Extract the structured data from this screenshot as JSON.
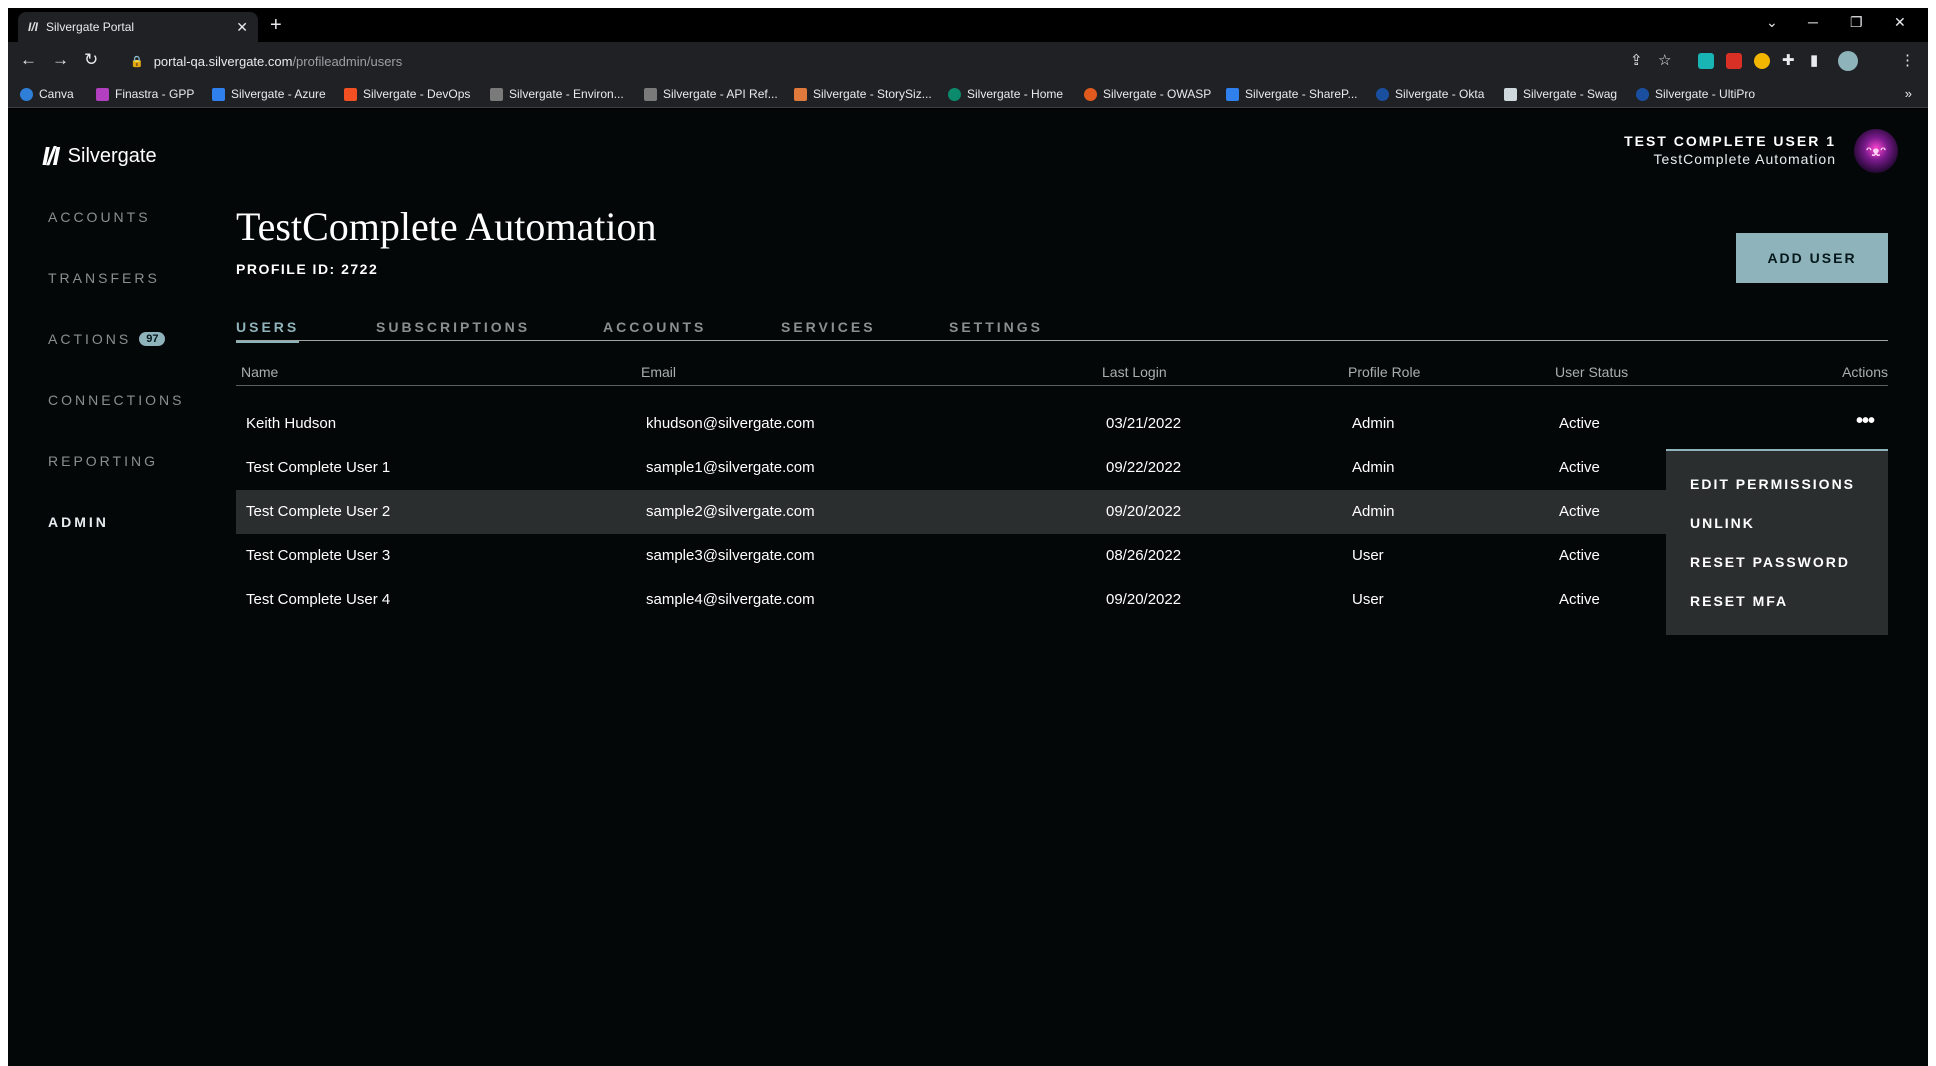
{
  "browser": {
    "tab_title": "Silvergate Portal",
    "tab_favicon": "I/I",
    "url_host": "portal-qa.silvergate.com",
    "url_path": "/profileadmin/users",
    "bookmarks": [
      {
        "label": "Canva",
        "color": "#2f7fd8"
      },
      {
        "label": "Finastra - GPP",
        "color": "#b23fbf"
      },
      {
        "label": "Silvergate - Azure",
        "color": "#2f80ed"
      },
      {
        "label": "Silvergate - DevOps",
        "color": "#f25022"
      },
      {
        "label": "Silvergate - Environ...",
        "color": "#7a7a7a"
      },
      {
        "label": "Silvergate - API Ref...",
        "color": "#7a7a7a"
      },
      {
        "label": "Silvergate - StorySiz...",
        "color": "#e07a3c"
      },
      {
        "label": "Silvergate - Home",
        "color": "#0b8a6c"
      },
      {
        "label": "Silvergate - OWASP",
        "color": "#e05a1e"
      },
      {
        "label": "Silvergate - ShareP...",
        "color": "#2f80ed"
      },
      {
        "label": "Silvergate - Okta",
        "color": "#1a4fa0"
      },
      {
        "label": "Silvergate - Swag",
        "color": "#cfd8dc"
      },
      {
        "label": "Silvergate - UltiPro",
        "color": "#1a4fa0"
      }
    ],
    "more_label": "»"
  },
  "app": {
    "logo_mark": "I/I",
    "logo_text": "Silvergate",
    "nav": {
      "accounts": "ACCOUNTS",
      "transfers": "TRANSFERS",
      "actions": "ACTIONS",
      "actions_badge": "97",
      "connections": "CONNECTIONS",
      "reporting": "REPORTING",
      "admin": "ADMIN"
    },
    "user": {
      "name": "TEST COMPLETE USER 1",
      "org": "TestComplete Automation"
    },
    "page_title": "TestComplete Automation",
    "profile_id": "PROFILE ID: 2722",
    "add_user_label": "ADD USER",
    "tabs": {
      "users": "USERS",
      "subscriptions": "SUBSCRIPTIONS",
      "accounts": "ACCOUNTS",
      "services": "SERVICES",
      "settings": "SETTINGS"
    },
    "table": {
      "headers": {
        "name": "Name",
        "email": "Email",
        "last_login": "Last Login",
        "profile_role": "Profile Role",
        "user_status": "User Status",
        "actions": "Actions"
      },
      "rows": [
        {
          "name": "Keith Hudson",
          "email": "khudson@silvergate.com",
          "last_login": "03/21/2022",
          "role": "Admin",
          "status": "Active"
        },
        {
          "name": "Test Complete User 1",
          "email": "sample1@silvergate.com",
          "last_login": "09/22/2022",
          "role": "Admin",
          "status": "Active"
        },
        {
          "name": "Test Complete User 2",
          "email": "sample2@silvergate.com",
          "last_login": "09/20/2022",
          "role": "Admin",
          "status": "Active"
        },
        {
          "name": "Test Complete User 3",
          "email": "sample3@silvergate.com",
          "last_login": "08/26/2022",
          "role": "User",
          "status": "Active"
        },
        {
          "name": "Test Complete User 4",
          "email": "sample4@silvergate.com",
          "last_login": "09/20/2022",
          "role": "User",
          "status": "Active"
        }
      ],
      "more_glyph": "•••"
    },
    "actions_menu": {
      "edit_permissions": "EDIT PERMISSIONS",
      "unlink": "UNLINK",
      "reset_password": "RESET PASSWORD",
      "reset_mfa": "RESET MFA"
    }
  }
}
